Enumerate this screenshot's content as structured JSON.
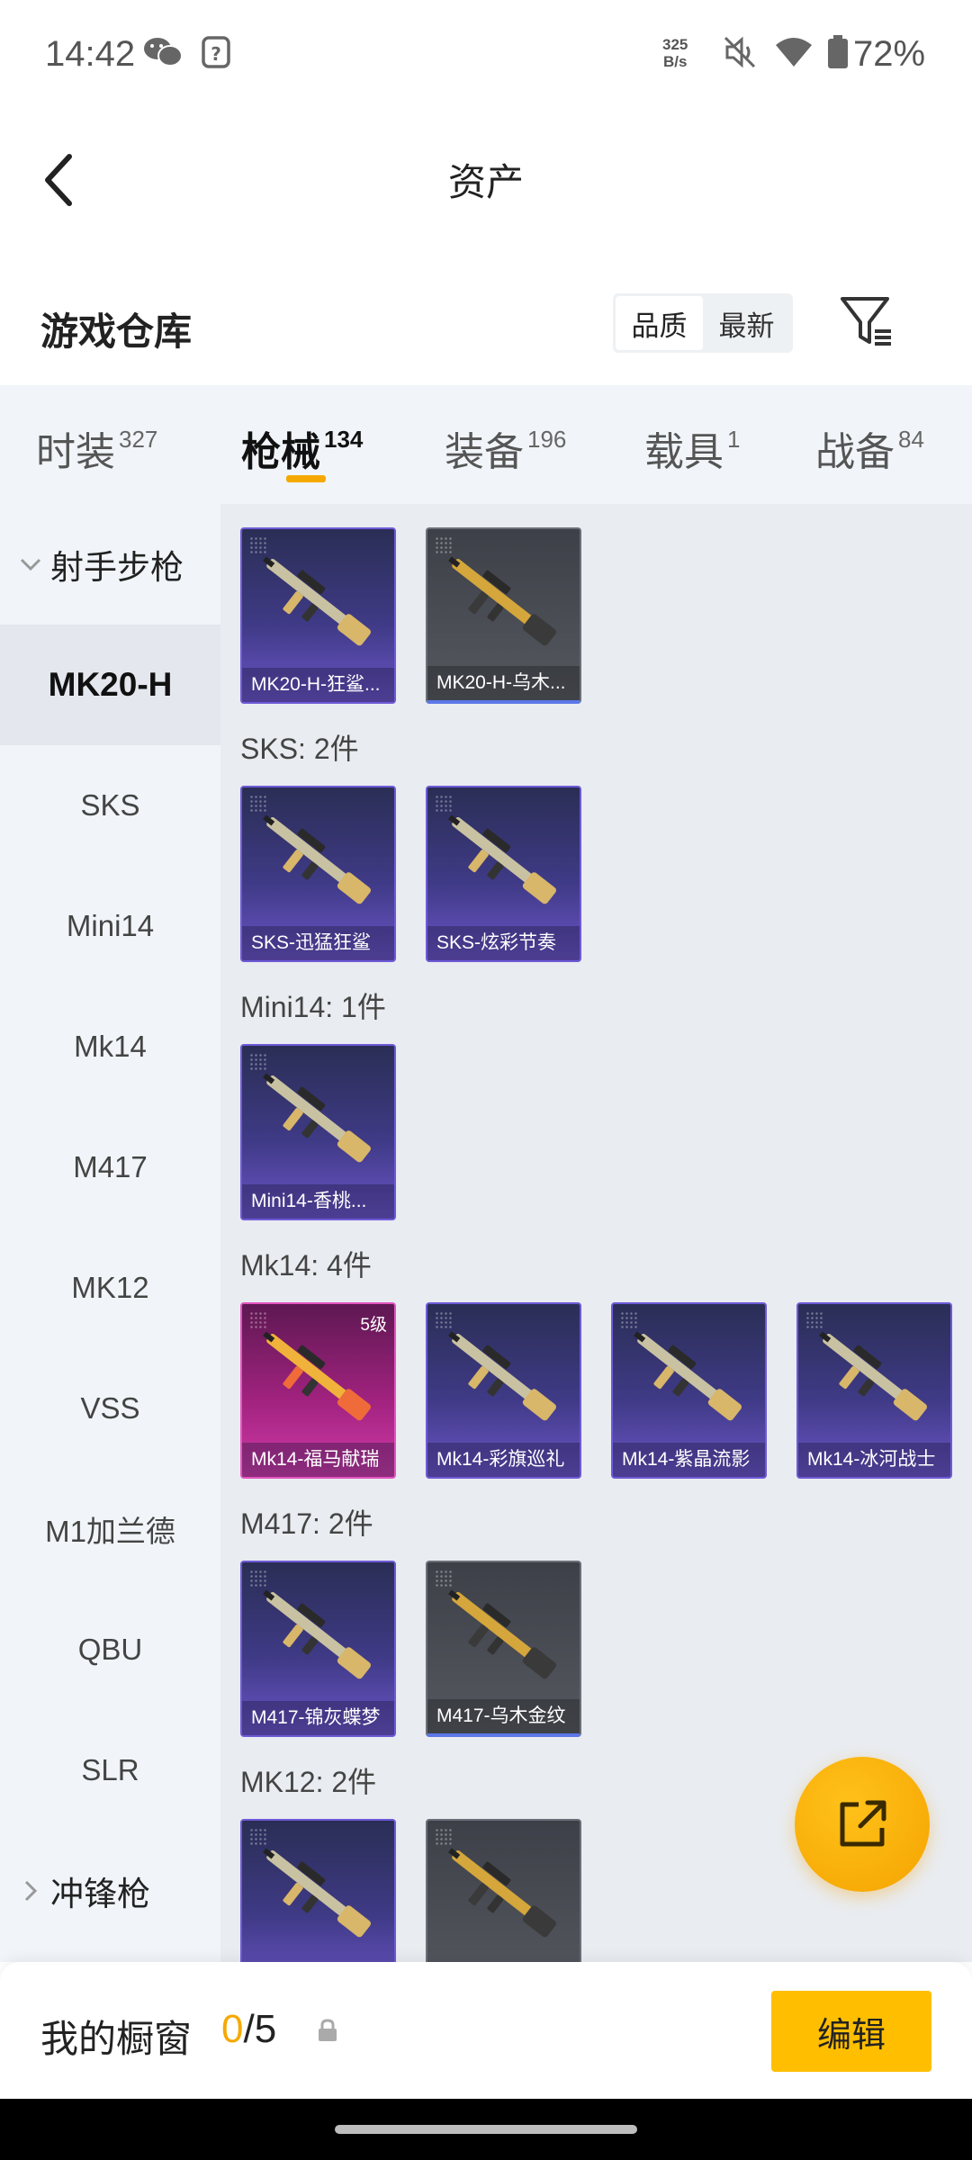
{
  "status_bar": {
    "time": "14:42",
    "speed_value": "325",
    "speed_unit": "B/s",
    "battery": "72%",
    "icons": [
      "wechat-icon",
      "question-box-icon",
      "mute-icon",
      "wifi-icon",
      "battery-icon"
    ]
  },
  "header": {
    "title": "资产",
    "back_icon": "chevron-left-icon"
  },
  "warehouse": {
    "title": "游戏仓库",
    "sort_options": [
      "品质",
      "最新"
    ],
    "sort_selected": "品质",
    "filter_icon": "filter-icon"
  },
  "tabs": [
    {
      "label": "时装",
      "count": "327"
    },
    {
      "label": "枪械",
      "count": "134"
    },
    {
      "label": "装备",
      "count": "196"
    },
    {
      "label": "载具",
      "count": "1"
    },
    {
      "label": "战备",
      "count": "84"
    }
  ],
  "active_tab": "枪械",
  "sidebar": {
    "group_open": "射手步枪",
    "items": [
      "MK20-H",
      "SKS",
      "Mini14",
      "Mk14",
      "M417",
      "MK12",
      "VSS",
      "M1加兰德",
      "QBU",
      "SLR"
    ],
    "active_item": "MK20-H",
    "group_collapsed": "冲锋枪"
  },
  "sections": [
    {
      "title": "",
      "items": [
        {
          "name": "MK20-H-狂鲨...",
          "style": "purple"
        },
        {
          "name": "MK20-H-乌木...",
          "style": "grey"
        }
      ]
    },
    {
      "title": "SKS: 2件",
      "items": [
        {
          "name": "SKS-迅猛狂鲨",
          "style": "purple"
        },
        {
          "name": "SKS-炫彩节奏",
          "style": "purple"
        }
      ]
    },
    {
      "title": "Mini14: 1件",
      "items": [
        {
          "name": "Mini14-香桃...",
          "style": "purple"
        }
      ]
    },
    {
      "title": "Mk14: 4件",
      "items": [
        {
          "name": "Mk14-福马献瑞",
          "style": "pink",
          "level": "5级"
        },
        {
          "name": "Mk14-彩旗巡礼",
          "style": "purple"
        },
        {
          "name": "Mk14-紫晶流影",
          "style": "purple"
        },
        {
          "name": "Mk14-冰河战士",
          "style": "purple"
        }
      ]
    },
    {
      "title": "M417: 2件",
      "items": [
        {
          "name": "M417-锦灰蝶梦",
          "style": "purple"
        },
        {
          "name": "M417-乌木金纹",
          "style": "grey"
        }
      ]
    },
    {
      "title": "MK12: 2件",
      "items": [
        {
          "name": "",
          "style": "purple"
        },
        {
          "name": "",
          "style": "grey"
        }
      ]
    }
  ],
  "fab_icon": "share-external-icon",
  "showcase": {
    "label": "我的橱窗",
    "current": "0",
    "separator": "/",
    "max": "5",
    "lock_icon": "lock-icon",
    "edit_label": "编辑"
  },
  "colors": {
    "accent": "#f5a900",
    "card_purple": "#3f3a86",
    "card_pink": "#a0227e",
    "card_grey": "#55585f"
  }
}
